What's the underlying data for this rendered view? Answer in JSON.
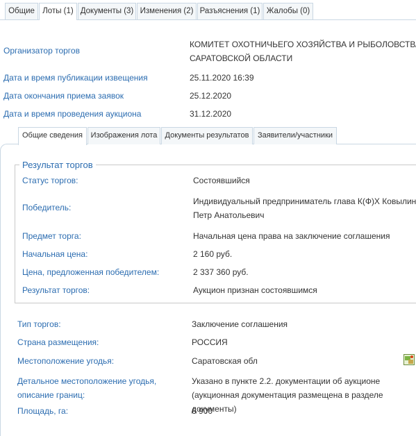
{
  "top_tabs": [
    "Общие",
    "Лоты (1)",
    "Документы (3)",
    "Изменения (2)",
    "Разъяснения (1)",
    "Жалобы (0)"
  ],
  "info": {
    "organizer_label": "Организатор торгов",
    "organizer_value": "КОМИТЕТ ОХОТНИЧЬЕГО ХОЗЯЙСТВА И РЫБОЛОВСТВА САРАТОВСКОЙ ОБЛАСТИ",
    "published_label": "Дата и время публикации извещения",
    "published_value": "25.11.2020 16:39",
    "deadline_label": "Дата окончания приема заявок",
    "deadline_value": "25.12.2020",
    "auction_label": "Дата и время проведения аукциона",
    "auction_value": "31.12.2020"
  },
  "inner_tabs": [
    "Общие сведения",
    "Изображения лота",
    "Документы результатов",
    "Заявители/участники"
  ],
  "result": {
    "legend": "Результат торгов",
    "status_label": "Статус торгов:",
    "status_value": "Состоявшийся",
    "winner_label": "Победитель:",
    "winner_value": "Индивидуальный предприниматель глава К(Ф)Х Ковылин Петр Анатольевич",
    "subject_label": "Предмет торга:",
    "subject_value": "Начальная цена права на заключение соглашения",
    "start_price_label": "Начальная цена:",
    "start_price_value": "2 160 руб.",
    "offered_price_label": "Цена, предложенная победителем:",
    "offered_price_value": "2 337 360 руб.",
    "outcome_label": "Результат торгов:",
    "outcome_value": "Аукцион признан состоявшимся"
  },
  "details": {
    "type_label": "Тип торгов:",
    "type_value": "Заключение соглашения",
    "country_label": "Страна размещения:",
    "country_value": "РОССИЯ",
    "location_label": "Местоположение угодья:",
    "location_value": "Саратовская обл",
    "location_icon": "map-icon",
    "detail_label": "Детальное местоположение угодья, описание границ:",
    "detail_value": "Указано в пункте 2.2. документации об аукционе (аукционная документация размещена в разделе документы)",
    "area_label": "Площадь, га:",
    "area_value": "6 900"
  }
}
